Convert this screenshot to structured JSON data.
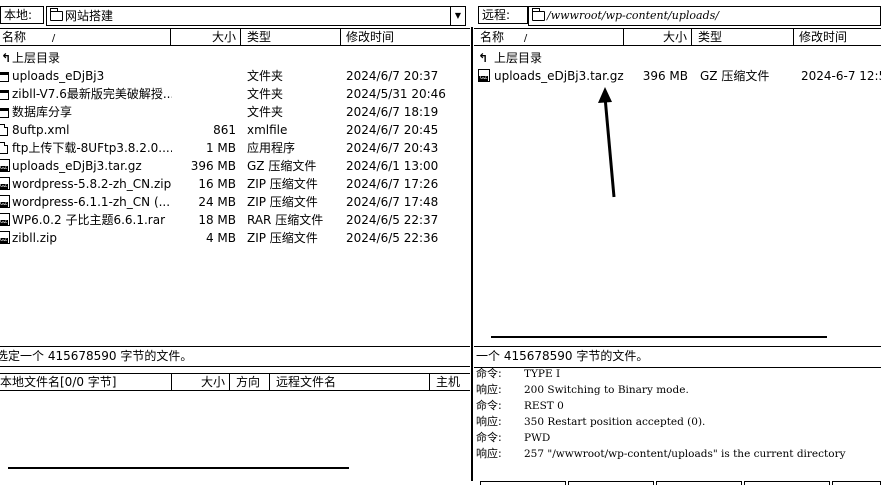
{
  "local": {
    "path_label": "本地:",
    "path": "网站搭建",
    "columns": {
      "name": "名称",
      "sort_mark": "/",
      "size": "大小",
      "type": "类型",
      "modified": "修改时间"
    },
    "rows": [
      {
        "icon": "up-dir-icon",
        "name": "上层目录",
        "size": "",
        "type": "",
        "modified": ""
      },
      {
        "icon": "folder-icon",
        "name": "uploads_eDjBj3",
        "size": "",
        "type": "文件夹",
        "modified": "2024/6/7 20:37"
      },
      {
        "icon": "folder-icon",
        "name": "zibll-V7.6最新版完美破解授...",
        "size": "",
        "type": "文件夹",
        "modified": "2024/5/31 20:46"
      },
      {
        "icon": "folder-icon",
        "name": "数据库分享",
        "size": "",
        "type": "文件夹",
        "modified": "2024/6/7 18:19"
      },
      {
        "icon": "file-icon",
        "name": "8uftp.xml",
        "size": "861",
        "type": "xmlfile",
        "modified": "2024/6/7 20:45"
      },
      {
        "icon": "app-icon",
        "name": "ftp上传下载-8UFtp3.8.2.0....",
        "size": "1 MB",
        "type": "应用程序",
        "modified": "2024/6/7 20:43"
      },
      {
        "icon": "archive-icon",
        "name": "uploads_eDjBj3.tar.gz",
        "size": "396 MB",
        "type": "GZ 压缩文件",
        "modified": "2024/6/1 13:00"
      },
      {
        "icon": "archive-icon",
        "name": "wordpress-5.8.2-zh_CN.zip",
        "size": "16 MB",
        "type": "ZIP 压缩文件",
        "modified": "2024/6/7 17:26"
      },
      {
        "icon": "archive-icon",
        "name": "wordpress-6.1.1-zh_CN (...",
        "size": "24 MB",
        "type": "ZIP 压缩文件",
        "modified": "2024/6/7 17:48"
      },
      {
        "icon": "archive-icon",
        "name": "WP6.0.2 子比主题6.6.1.rar",
        "size": "18 MB",
        "type": "RAR 压缩文件",
        "modified": "2024/6/5 22:37"
      },
      {
        "icon": "archive-icon",
        "name": "zibll.zip",
        "size": "4 MB",
        "type": "ZIP 压缩文件",
        "modified": "2024/6/5 22:36"
      }
    ],
    "status": "选定一个 415678590 字节的文件。"
  },
  "remote": {
    "path_label": "远程:",
    "path": "/wwwroot/wp-content/uploads/",
    "columns": {
      "name": "名称",
      "sort_mark": "/",
      "size": "大小",
      "type": "类型",
      "modified": "修改时间"
    },
    "rows": [
      {
        "icon": "up-dir-icon",
        "name": "上层目录",
        "size": "",
        "type": "",
        "modified": ""
      },
      {
        "icon": "archive-icon",
        "name": "uploads_eDjBj3.tar.gz",
        "size": "396 MB",
        "type": "GZ 压缩文件",
        "modified": "2024-6-7 12:5"
      }
    ],
    "status": "一个 415678590 字节的文件。"
  },
  "queue": {
    "columns": {
      "local_name": "本地文件名[0/0 字节]",
      "size": "大小",
      "direction": "方向",
      "remote_name": "远程文件名",
      "host": "主机"
    }
  },
  "log": [
    {
      "kind": "命令:",
      "text": "TYPE I"
    },
    {
      "kind": "响应:",
      "text": "200 Switching to Binary mode."
    },
    {
      "kind": "命令:",
      "text": "REST 0"
    },
    {
      "kind": "响应:",
      "text": "350 Restart position accepted (0)."
    },
    {
      "kind": "命令:",
      "text": "PWD"
    },
    {
      "kind": "响应:",
      "text": "257 \"/wwwroot/wp-content/uploads\" is the current directory"
    }
  ],
  "annotation": {
    "type": "arrow",
    "points_to": "uploads_eDjBj3.tar.gz"
  }
}
